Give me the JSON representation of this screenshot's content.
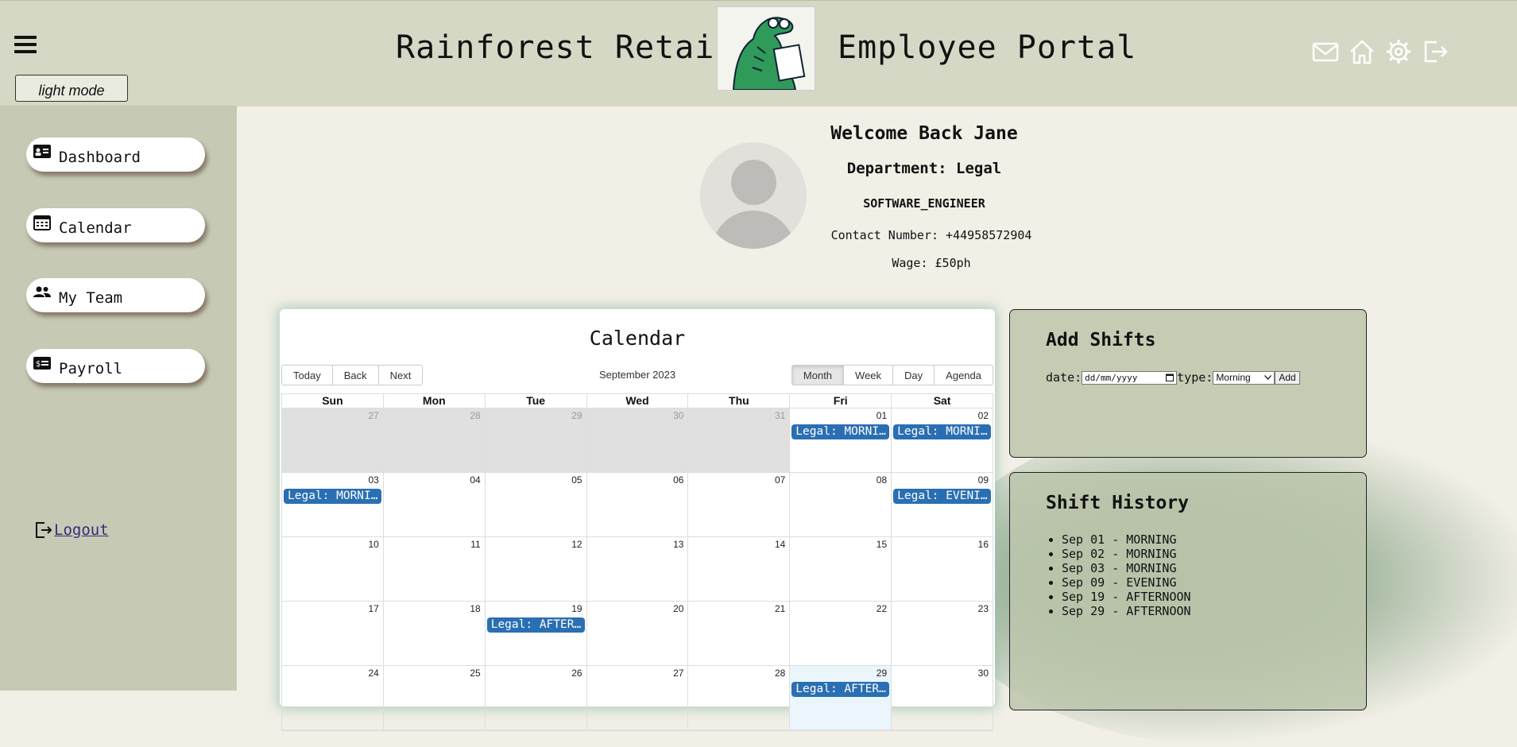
{
  "header": {
    "brand_left": "Rainforest Retail",
    "brand_right": "Employee Portal",
    "mode_button": "light mode",
    "icons": [
      "mail-icon",
      "home-icon",
      "settings-icon",
      "logout-icon"
    ]
  },
  "sidebar": {
    "items": [
      {
        "label": "Dashboard",
        "icon": "id-card-icon"
      },
      {
        "label": "Calendar",
        "icon": "calendar-icon"
      },
      {
        "label": "My Team",
        "icon": "team-icon"
      },
      {
        "label": "Payroll",
        "icon": "payroll-icon"
      }
    ],
    "logout_label": " Logout"
  },
  "profile": {
    "welcome": "Welcome Back Jane",
    "department": "Department: Legal",
    "role": "SOFTWARE_ENGINEER",
    "contact": "Contact Number: +44958572904",
    "wage": "Wage: £50ph"
  },
  "calendar": {
    "title": "Calendar",
    "nav_buttons": [
      "Today",
      "Back",
      "Next"
    ],
    "label": "September 2023",
    "view_buttons": [
      "Month",
      "Week",
      "Day",
      "Agenda"
    ],
    "active_view": "Month",
    "weekdays": [
      "Sun",
      "Mon",
      "Tue",
      "Wed",
      "Thu",
      "Fri",
      "Sat"
    ],
    "weeks": [
      [
        {
          "day": "27",
          "off": true
        },
        {
          "day": "28",
          "off": true
        },
        {
          "day": "29",
          "off": true
        },
        {
          "day": "30",
          "off": true
        },
        {
          "day": "31",
          "off": true
        },
        {
          "day": "01",
          "event": "Legal: MORNING"
        },
        {
          "day": "02",
          "event": "Legal: MORNING"
        }
      ],
      [
        {
          "day": "03",
          "event": "Legal: MORNING"
        },
        {
          "day": "04"
        },
        {
          "day": "05"
        },
        {
          "day": "06"
        },
        {
          "day": "07"
        },
        {
          "day": "08"
        },
        {
          "day": "09",
          "event": "Legal: EVENING"
        }
      ],
      [
        {
          "day": "10"
        },
        {
          "day": "11"
        },
        {
          "day": "12"
        },
        {
          "day": "13"
        },
        {
          "day": "14"
        },
        {
          "day": "15"
        },
        {
          "day": "16"
        }
      ],
      [
        {
          "day": "17"
        },
        {
          "day": "18"
        },
        {
          "day": "19",
          "event": "Legal: AFTERNOON"
        },
        {
          "day": "20"
        },
        {
          "day": "21"
        },
        {
          "day": "22"
        },
        {
          "day": "23"
        }
      ],
      [
        {
          "day": "24"
        },
        {
          "day": "25"
        },
        {
          "day": "26"
        },
        {
          "day": "27"
        },
        {
          "day": "28"
        },
        {
          "day": "29",
          "event": "Legal: AFTERNOON",
          "today": true
        },
        {
          "day": "30"
        }
      ]
    ]
  },
  "add_shifts": {
    "title": "Add Shifts",
    "date_label": "date:",
    "date_placeholder": "dd/mm/yyyy",
    "type_label": "type:",
    "type_value": "Morning",
    "add_button": "Add"
  },
  "shift_history": {
    "title": "Shift History",
    "items": [
      "Sep 01 - MORNING",
      "Sep 02 - MORNING",
      "Sep 03 - MORNING",
      "Sep 09 - EVENING",
      "Sep 19 - AFTERNOON",
      "Sep 29 - AFTERNOON"
    ]
  },
  "colors": {
    "header_bg": "#d5d8c5",
    "sidebar_bg": "#c6cab5",
    "event_blue": "#2a6fb3",
    "panel_bg": "#c4ccb4"
  }
}
